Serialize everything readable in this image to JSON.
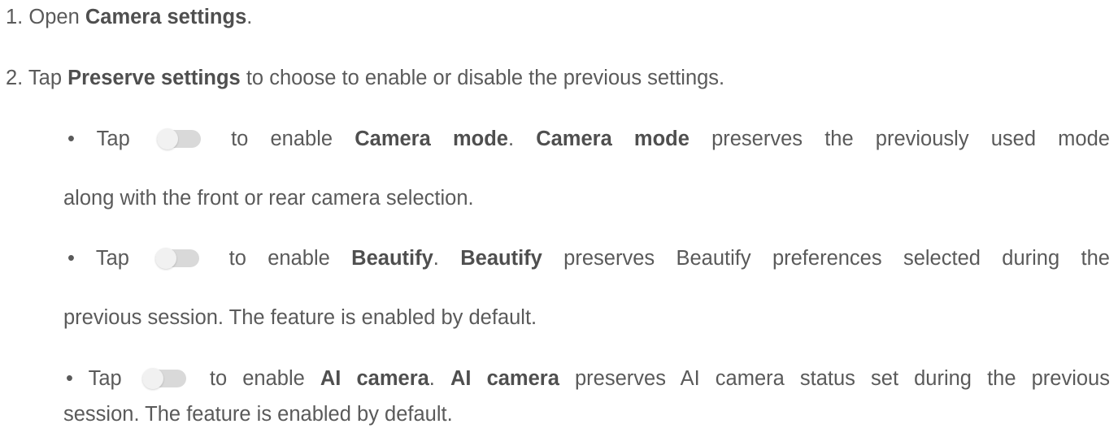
{
  "steps": [
    {
      "num": "1.",
      "pre": "Open",
      "bold": "Camera settings",
      "post": "."
    },
    {
      "num": "2.",
      "pre": "Tap",
      "bold": "Preserve settings",
      "post": "to choose to enable or disable the previous settings."
    }
  ],
  "bullets": [
    {
      "marker": "•",
      "tap": "Tap",
      "mid": "to enable",
      "term": "Camera mode",
      "dot": ".",
      "term2": "Camera mode",
      "line1_rest": "preserves the previously used mode",
      "line2": "along with the front or rear camera selection."
    },
    {
      "marker": "•",
      "tap": "Tap",
      "mid": "to enable",
      "term": "Beautify",
      "dot": ".",
      "term2": "Beautify",
      "line1_rest": "preserves Beautify preferences selected during the",
      "line2": "previous session. The feature is enabled by default."
    },
    {
      "marker": "•",
      "tap": "Tap",
      "mid": "to enable",
      "term": "AI camera",
      "dot": ".",
      "term2": "AI camera",
      "line1_rest": "preserves AI camera status set during the previous",
      "line2": "session. The feature is enabled by default."
    }
  ],
  "toggle_state": "off",
  "colors": {
    "text": "#5a5a5a",
    "toggle_track": "#d9d9d9",
    "toggle_knob": "#f1f1f1"
  }
}
